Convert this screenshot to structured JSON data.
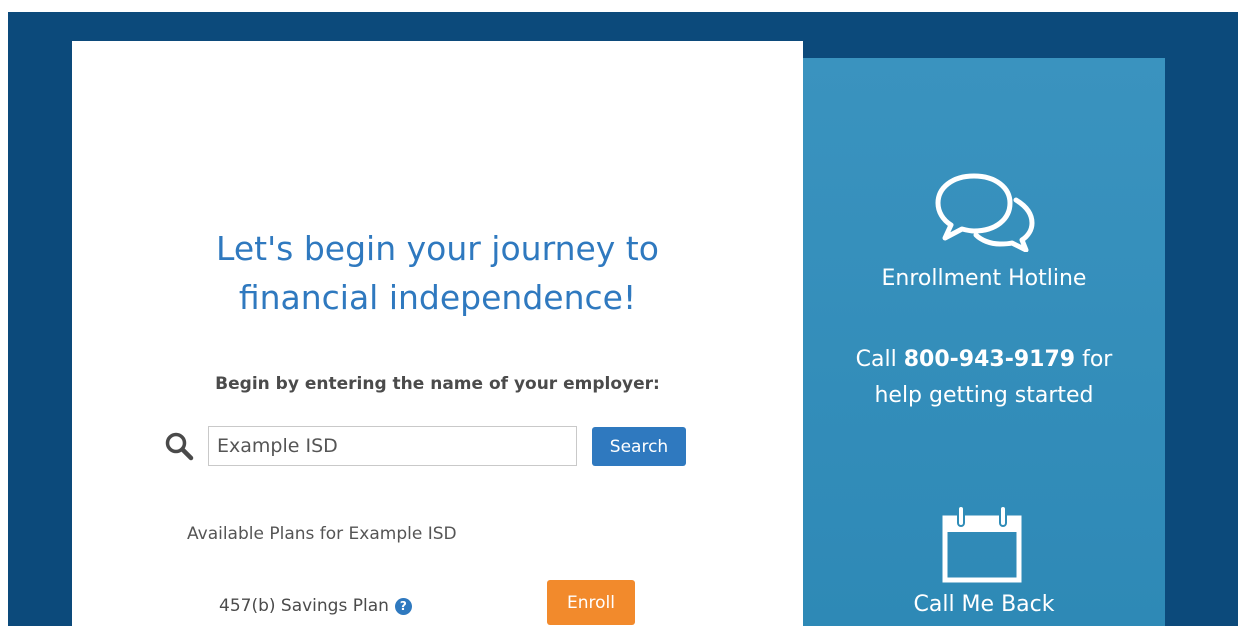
{
  "main": {
    "headline_line1": "Let's begin your journey to",
    "headline_line2": "financial independence!",
    "prompt": "Begin by entering the name of your employer:",
    "search": {
      "value": "Example ISD",
      "button_label": "Search",
      "icon": "search-icon"
    },
    "plans_heading": "Available Plans for Example ISD",
    "plans": [
      {
        "name": "457(b) Savings Plan",
        "help_icon": "question-circle-icon",
        "button_label": "Enroll"
      }
    ]
  },
  "sidebar": {
    "hotline": {
      "icon": "chat-bubbles-icon",
      "title": "Enrollment Hotline",
      "text_prefix": "Call",
      "phone": "800-943-9179",
      "text_suffix": "for",
      "text_line2": "help getting started"
    },
    "callback": {
      "icon": "calendar-icon",
      "label": "Call Me Back"
    }
  },
  "colors": {
    "frame": "#0c4a7b",
    "sidebar": "#2f8cb7",
    "accent_blue": "#2f79bf",
    "enroll_orange": "#f28a2c"
  }
}
